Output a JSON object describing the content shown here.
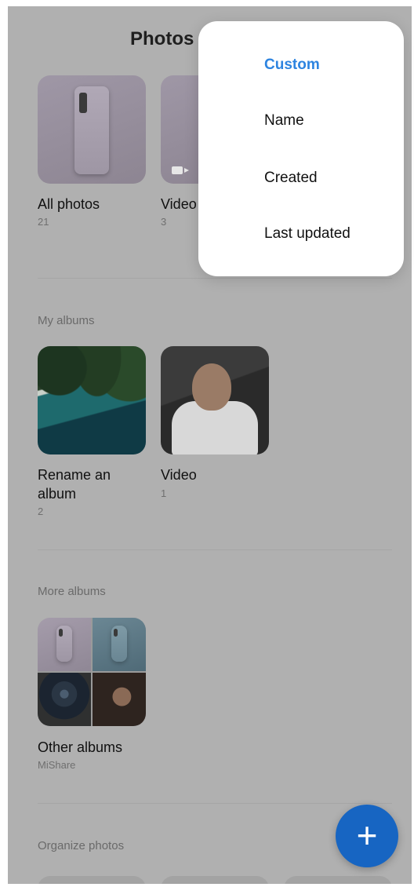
{
  "header": {
    "title": "Photos"
  },
  "top_albums": [
    {
      "label": "All photos",
      "count": "21"
    },
    {
      "label": "Video",
      "count": "3"
    }
  ],
  "my_albums": {
    "section_title": "My albums",
    "items": [
      {
        "label": "Rename an album",
        "count": "2"
      },
      {
        "label": "Video",
        "count": "1"
      }
    ]
  },
  "more_albums": {
    "section_title": "More albums",
    "items": [
      {
        "label": "Other albums",
        "subtitle": "MiShare"
      }
    ]
  },
  "organize": {
    "section_title": "Organize photos"
  },
  "sort_menu": {
    "items": [
      {
        "label": "Custom",
        "selected": true
      },
      {
        "label": "Name"
      },
      {
        "label": "Created"
      },
      {
        "label": "Last updated"
      }
    ]
  },
  "fab": {
    "label": "+"
  },
  "colors": {
    "accent": "#2d84e0",
    "fab": "#1765c2",
    "scrim": "#b0b0b0"
  },
  "icons": [
    "video-icon",
    "plus-icon"
  ]
}
